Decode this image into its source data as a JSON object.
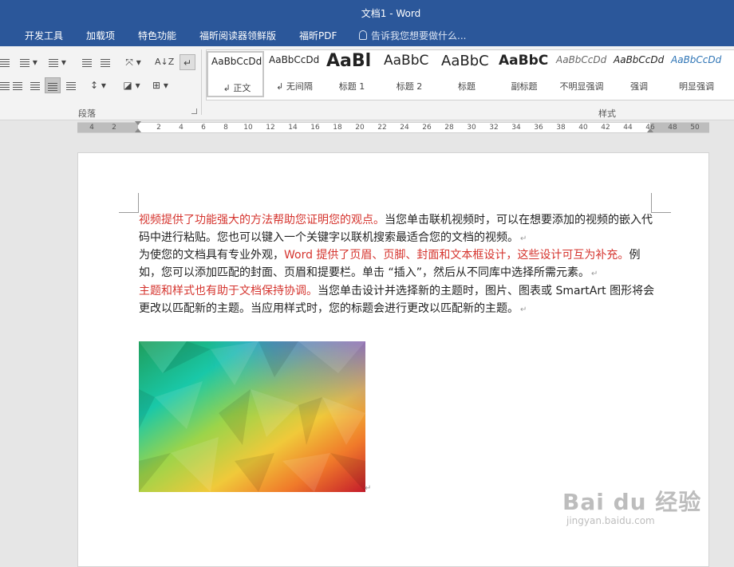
{
  "window": {
    "title": "文档1 - Word"
  },
  "tabs": [
    "开发工具",
    "加载项",
    "特色功能",
    "福昕阅读器领鲜版",
    "福昕PDF"
  ],
  "tell_me": {
    "placeholder": "告诉我您想要做什么..."
  },
  "ribbon": {
    "paragraph_group_label": "段落",
    "styles_group_label": "样式",
    "sort_label": "A↓Z",
    "styles": [
      {
        "preview": "AaBbCcDd",
        "name": "↲ 正文"
      },
      {
        "preview": "AaBbCcDd",
        "name": "↲ 无间隔"
      },
      {
        "preview": "AaBl",
        "name": "标题 1"
      },
      {
        "preview": "AaBbC",
        "name": "标题 2"
      },
      {
        "preview": "AaBbC",
        "name": "标题"
      },
      {
        "preview": "AaBbC",
        "name": "副标题"
      },
      {
        "preview": "AaBbCcDd",
        "name": "不明显强调"
      },
      {
        "preview": "AaBbCcDd",
        "name": "强调"
      },
      {
        "preview": "AaBbCcDd",
        "name": "明显强调"
      }
    ]
  },
  "ruler": {
    "left_ticks": [
      "4",
      "2"
    ],
    "right_ticks": [
      "2",
      "4",
      "6",
      "8",
      "10",
      "12",
      "14",
      "16",
      "18",
      "20",
      "22",
      "24",
      "26",
      "28",
      "30",
      "32",
      "34",
      "36",
      "38",
      "40",
      "42",
      "44",
      "46",
      "48",
      "50"
    ]
  },
  "document": {
    "p1": {
      "red1": "视频提供了功能强大的方法帮助您证明您的观点。",
      "t1": "当您单击联机视频时，可以在想要添加的视频的嵌入代码中进行粘贴。您也可以键入一个关键字以联机搜索最适合您的文档的视频。",
      "mark": "↵"
    },
    "p2": {
      "t1": "为使您的文档具有专业外观，",
      "red1": "Word 提供了页眉、页脚、封面和文本框设计，这些设计可互为补充。",
      "t2": "例如，您可以添加匹配的封面、页眉和提要栏。单击 “插入”，然后从不同库中选择所需元素。",
      "mark": "↵"
    },
    "p3": {
      "red1": "主题和样式也有助于文档保持协调。",
      "t1": "当您单击设计并选择新的主题时，图片、图表或 SmartArt 图形将会更改以匹配新的主题。当应用样式时，您的标题会进行更改以匹配新的主题。",
      "mark": "↵"
    },
    "image_mark": "↵"
  },
  "watermark": {
    "brand": "Bai du 经验",
    "url": "jingyan.baidu.com"
  }
}
